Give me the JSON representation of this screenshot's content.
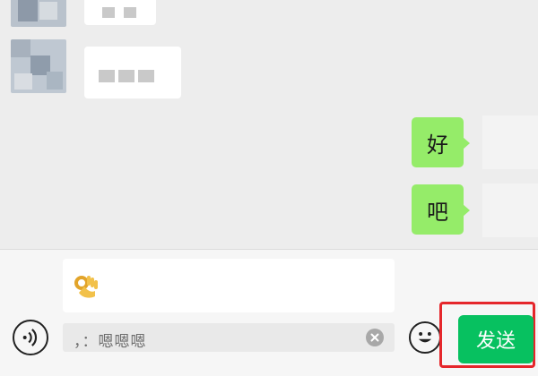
{
  "chat": {
    "incoming": [
      {
        "text_redacted": true
      },
      {
        "text_redacted": true
      }
    ],
    "outgoing": [
      {
        "text": "好"
      },
      {
        "text": "吧"
      }
    ],
    "bubble_color": "#95ec69"
  },
  "composer": {
    "emoji_icon": "ok-hand-emoji",
    "quote_text": "，：嗯嗯嗯"
  },
  "toolbar": {
    "voice_icon": "voice-icon",
    "emoji_icon": "smiley-icon",
    "send_label": "发送",
    "send_color": "#07c160",
    "highlight_color": "#e5262b"
  }
}
